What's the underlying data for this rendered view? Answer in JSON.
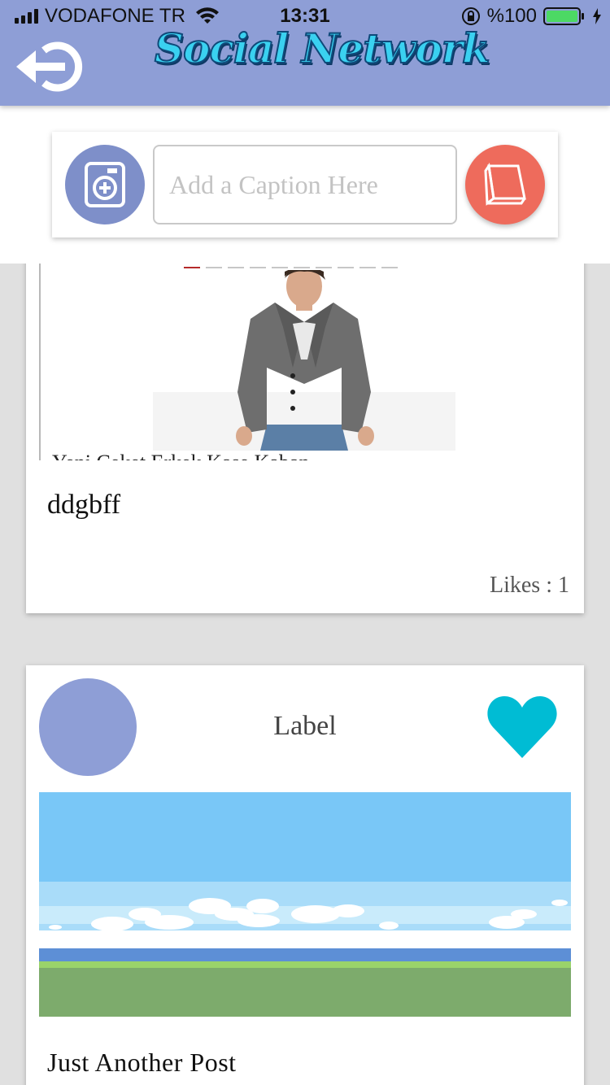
{
  "status_bar": {
    "carrier": "VODAFONE TR",
    "time": "13:31",
    "battery": "%100",
    "signal_bars": 4,
    "battery_level": 1.0
  },
  "header": {
    "logo_text": "Social Network",
    "back_icon": "logout-arrow-icon",
    "background_color": "#8e9ed6"
  },
  "composer": {
    "caption_placeholder": "Add a Caption Here",
    "caption_value": "",
    "camera_icon": "camera-plus-icon",
    "post_icon": "notepad-icon",
    "camera_color": "#7e8fc9",
    "post_color": "#ee6b5c"
  },
  "posts": [
    {
      "caption": "ddgbff",
      "likes_label": "Likes :  1",
      "cut_off_text": "Yeni Ceket Erkek Kaşe Kaban",
      "pager_count": 10,
      "pager_active_index": 0
    },
    {
      "username": "Label",
      "caption": "Just Another Post",
      "like_icon": "heart-icon",
      "like_color": "#00bcd4",
      "avatar_color": "#8e9ed6"
    }
  ]
}
